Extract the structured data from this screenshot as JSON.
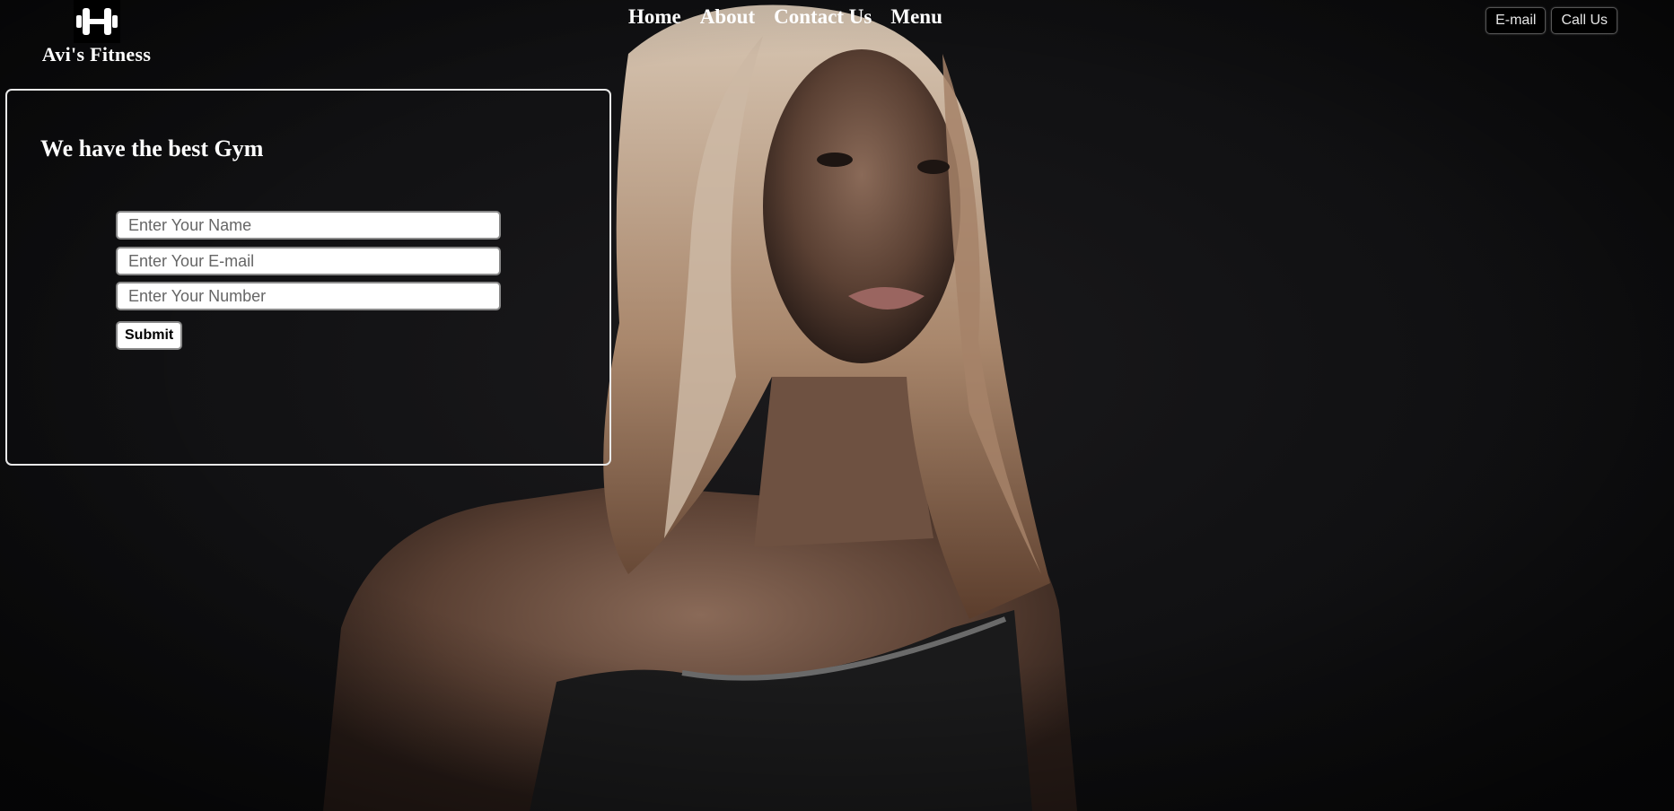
{
  "brand": {
    "name": "Avi's Fitness",
    "logo_icon": "dumbbell-icon"
  },
  "nav": {
    "items": [
      "Home",
      "About",
      "Contact Us",
      "Menu"
    ]
  },
  "top_actions": {
    "email_label": "E-mail",
    "call_label": "Call Us"
  },
  "form": {
    "title": "We have the best Gym",
    "name_placeholder": "Enter Your Name",
    "email_placeholder": "Enter Your E-mail",
    "number_placeholder": "Enter Your Number",
    "submit_label": "Submit"
  },
  "colors": {
    "background": "#0d0d0f",
    "text": "#ffffff",
    "card_border": "#e9e9e9"
  }
}
